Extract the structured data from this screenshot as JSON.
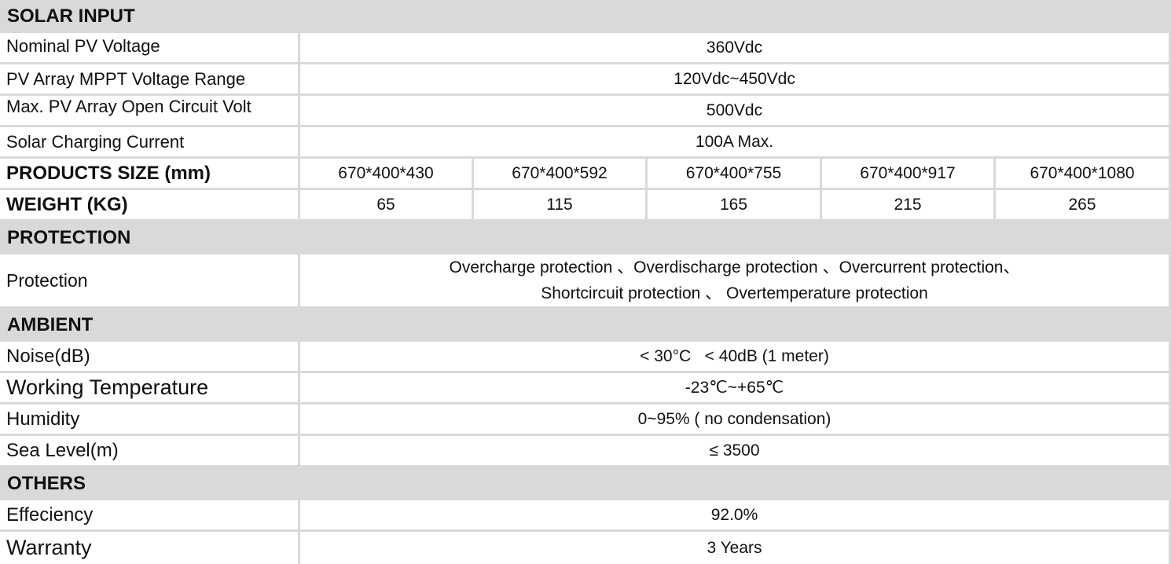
{
  "solar_input": {
    "title": "SOLAR INPUT",
    "rows": [
      {
        "label": "Nominal PV Voltage",
        "value": "360Vdc"
      },
      {
        "label": "PV Array MPPT Voltage Range",
        "value": "120Vdc~450Vdc"
      },
      {
        "label": "Max. PV Array Open Circuit Volt",
        "value": "500Vdc"
      },
      {
        "label": "Solar Charging Current",
        "value": "100A Max."
      }
    ]
  },
  "size": {
    "label": "PRODUCTS SIZE (mm)",
    "values": [
      "670*400*430",
      "670*400*592",
      "670*400*755",
      "670*400*917",
      "670*400*1080"
    ]
  },
  "weight": {
    "label": "WEIGHT (KG)",
    "values": [
      "65",
      "115",
      "165",
      "215",
      "265"
    ]
  },
  "protection": {
    "title": "PROTECTION",
    "label": "Protection",
    "line1": "Overcharge protection 、Overdischarge protection 、Overcurrent protection、",
    "line2": "Shortcircuit protection 、 Overtemperature protection"
  },
  "ambient": {
    "title": "AMBIENT",
    "rows": [
      {
        "label": "Noise(dB)",
        "value": "< 30°C   < 40dB (1 meter)"
      },
      {
        "label": "Working Temperature",
        "value": "-23℃~+65℃"
      },
      {
        "label": "Humidity",
        "value": "0~95% ( no condensation)"
      },
      {
        "label": "Sea Level(m)",
        "value": "≤ 3500"
      }
    ]
  },
  "others": {
    "title": "OTHERS",
    "rows": [
      {
        "label": "Effeciency",
        "value": "92.0%"
      },
      {
        "label": "Warranty",
        "value": "3 Years"
      }
    ]
  }
}
